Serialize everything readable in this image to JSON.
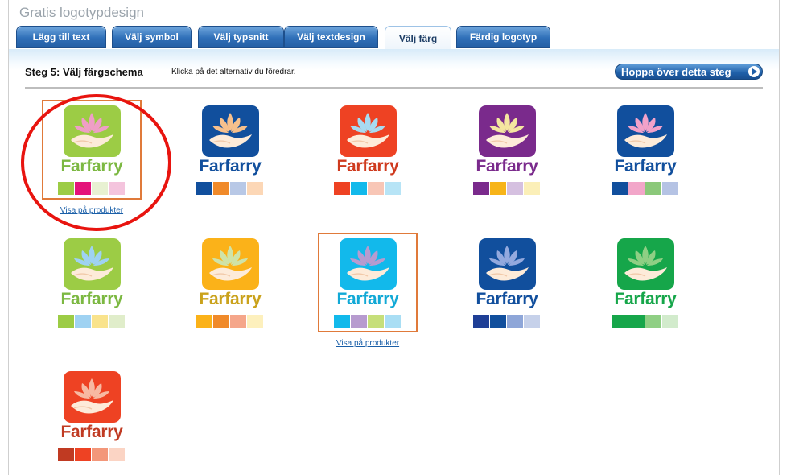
{
  "app": {
    "title": "Gratis logotypdesign"
  },
  "tabs": [
    {
      "label": "Lägg till text",
      "active": false
    },
    {
      "label": "Välj symbol",
      "active": false
    },
    {
      "label": "Välj typsnitt",
      "active": false
    },
    {
      "label": "Välj textdesign",
      "active": false
    },
    {
      "label": "Välj färg",
      "active": true
    },
    {
      "label": "Färdig logotyp",
      "active": false
    }
  ],
  "step": {
    "title": "Steg 5: Välj färgschema",
    "hint": "Klicka på det alternativ du föredrar.",
    "skip_label": "Hoppa över detta steg"
  },
  "link_label": "Visa på produkter",
  "options": [
    {
      "brand": "Farfarry",
      "tile": "#9ccc45",
      "flower": "#ef9ec6",
      "text": "#7cb842",
      "swatches": [
        "#9ccc45",
        "#e4147a",
        "#e8f1d2",
        "#f4c4dd"
      ],
      "selected": true,
      "link": true
    },
    {
      "brand": "Farfarry",
      "tile": "#114f9d",
      "flower": "#f7c08c",
      "text": "#114f9d",
      "swatches": [
        "#114f9d",
        "#f08a2a",
        "#b8c8e6",
        "#fcd7b6"
      ],
      "selected": false,
      "link": false
    },
    {
      "brand": "Farfarry",
      "tile": "#ee4223",
      "flower": "#a7dbf1",
      "text": "#cf3a1e",
      "swatches": [
        "#ee4223",
        "#12b9eb",
        "#f8c6b6",
        "#b7e4f6"
      ],
      "selected": false,
      "link": false
    },
    {
      "brand": "Farfarry",
      "tile": "#7a2a8c",
      "flower": "#f4e6a0",
      "text": "#7a2a8c",
      "swatches": [
        "#7a2a8c",
        "#f7b419",
        "#d5c0e0",
        "#fbefb8"
      ],
      "selected": false,
      "link": false
    },
    {
      "brand": "Farfarry",
      "tile": "#114f9d",
      "flower": "#f3a2c9",
      "text": "#114f9d",
      "swatches": [
        "#114f9d",
        "#f2a6c9",
        "#8bc87a",
        "#b5c3e4"
      ],
      "selected": false,
      "link": false
    },
    {
      "brand": "Farfarry",
      "tile": "#9ccc45",
      "flower": "#9fd2f2",
      "text": "#7cb842",
      "swatches": [
        "#9ccc45",
        "#9fd2f2",
        "#f9e38c",
        "#e0edca"
      ],
      "selected": false,
      "link": false
    },
    {
      "brand": "Farfarry",
      "tile": "#fbb219",
      "flower": "#cfe3a8",
      "text": "#caa21c",
      "swatches": [
        "#fbb219",
        "#f08a2a",
        "#f5a68a",
        "#fdf0bd"
      ],
      "selected": false,
      "link": false
    },
    {
      "brand": "Farfarry",
      "tile": "#12b9eb",
      "flower": "#b79bcf",
      "text": "#12a9d6",
      "swatches": [
        "#12b9eb",
        "#b79bcf",
        "#c6df7a",
        "#a9def4"
      ],
      "selected": true,
      "link": true
    },
    {
      "brand": "Farfarry",
      "tile": "#114f9d",
      "flower": "#93a9de",
      "text": "#114f9d",
      "swatches": [
        "#1f3f96",
        "#114f9d",
        "#8ea6d8",
        "#c6d1ea"
      ],
      "selected": false,
      "link": false
    },
    {
      "brand": "Farfarry",
      "tile": "#16a64a",
      "flower": "#8fcf84",
      "text": "#16a64a",
      "swatches": [
        "#16a64a",
        "#16a64a",
        "#8fcf84",
        "#d2ebcc"
      ],
      "selected": false,
      "link": false
    },
    {
      "brand": "Farfarry",
      "tile": "#ee4223",
      "flower": "#f7b9a2",
      "text": "#c03a22",
      "swatches": [
        "#c03a22",
        "#ee4223",
        "#f3977a",
        "#fbd4c4"
      ],
      "selected": false,
      "link": false
    }
  ]
}
